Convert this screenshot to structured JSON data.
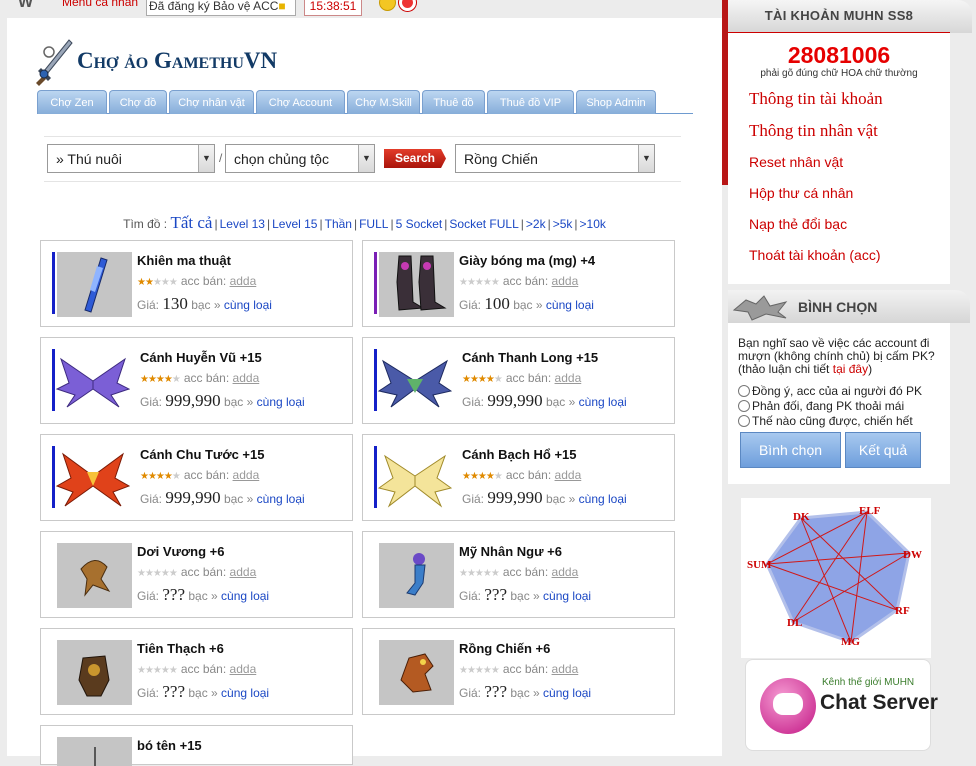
{
  "topbar": {
    "logo_letter": "W",
    "menu_label": "Menu cá nhân",
    "register_box": "Đã đăng ký Bảo vệ ACC",
    "clock": "15:38:51"
  },
  "brand": {
    "title": "Chợ ảo GamethuVN"
  },
  "tabs": [
    "Chợ Zen",
    "Chợ đồ",
    "Chợ nhân vật",
    "Chợ Account",
    "Chợ M.Skill",
    "Thuê đồ",
    "Thuê đồ VIP",
    "Shop Admin"
  ],
  "filters": {
    "category": "» Thú nuôi",
    "race": "chọn chủng tộc",
    "search_label": "Search",
    "item": "Rồng Chiến"
  },
  "quicklinks": {
    "prefix": "Tìm đồ :",
    "all": "Tất cả",
    "links": [
      "Level 13",
      "Level 15",
      "Thần",
      "FULL",
      "5 Socket",
      "Socket FULL",
      ">2k",
      ">5k",
      ">10k"
    ]
  },
  "items": [
    {
      "name": "Khiên ma thuật",
      "stars": 2,
      "seller_label": "acc bán:",
      "seller": "adda",
      "price_label": "Giá:",
      "price": "130",
      "currency": "bạc",
      "same": "cùng loại"
    },
    {
      "name": "Giày bóng ma (mg) +4",
      "stars": 0,
      "seller_label": "acc bán:",
      "seller": "adda",
      "price_label": "Giá:",
      "price": "100",
      "currency": "bạc",
      "same": "cùng loại"
    },
    {
      "name": "Cánh Huyễn Vũ +15",
      "stars": 4,
      "seller_label": "acc bán:",
      "seller": "adda",
      "price_label": "Giá:",
      "price": "999,990",
      "currency": "bạc",
      "same": "cùng loại"
    },
    {
      "name": "Cánh Thanh Long +15",
      "stars": 4,
      "seller_label": "acc bán:",
      "seller": "adda",
      "price_label": "Giá:",
      "price": "999,990",
      "currency": "bạc",
      "same": "cùng loại"
    },
    {
      "name": "Cánh Chu Tước +15",
      "stars": 4,
      "seller_label": "acc bán:",
      "seller": "adda",
      "price_label": "Giá:",
      "price": "999,990",
      "currency": "bạc",
      "same": "cùng loại"
    },
    {
      "name": "Cánh Bạch Hổ +15",
      "stars": 4,
      "seller_label": "acc bán:",
      "seller": "adda",
      "price_label": "Giá:",
      "price": "999,990",
      "currency": "bạc",
      "same": "cùng loại"
    },
    {
      "name": "Dơi Vương +6",
      "stars": 0,
      "seller_label": "acc bán:",
      "seller": "adda",
      "price_label": "Giá:",
      "price": "???",
      "currency": "bạc",
      "same": "cùng loại"
    },
    {
      "name": "Mỹ Nhân Ngư +6",
      "stars": 0,
      "seller_label": "acc bán:",
      "seller": "adda",
      "price_label": "Giá:",
      "price": "???",
      "currency": "bạc",
      "same": "cùng loại"
    },
    {
      "name": "Tiên Thạch +6",
      "stars": 0,
      "seller_label": "acc bán:",
      "seller": "adda",
      "price_label": "Giá:",
      "price": "???",
      "currency": "bạc",
      "same": "cùng loại"
    },
    {
      "name": "Rồng Chiến +6",
      "stars": 0,
      "seller_label": "acc bán:",
      "seller": "adda",
      "price_label": "Giá:",
      "price": "???",
      "currency": "bạc",
      "same": "cùng loại"
    },
    {
      "name": "bó tên +15"
    }
  ],
  "account": {
    "title": "TÀI KHOẢN MUHN SS8",
    "code": "28081006",
    "hint": "phải gõ đúng chữ HOA chữ thường",
    "links": [
      "Thông tin tài khoản",
      "Thông tin nhân vật",
      "Reset nhân vật",
      "Hộp thư cá nhân",
      "Nạp thẻ đổi bạc",
      "Thoát tài khoản (acc)"
    ]
  },
  "poll": {
    "title": "BÌNH CHỌN",
    "question": "Bạn nghĩ sao về việc các account đi mượn (không chính chủ) bị cấm PK? (thảo luận chi tiết",
    "question_link": "tại đây",
    "question_end": ")",
    "options": [
      "Đồng ý, acc của ai người đó PK",
      "Phản đối, đang PK thoải mái",
      "Thế nào cũng được, chiến hết"
    ],
    "vote_label": "Bình chọn",
    "result_label": "Kết quả"
  },
  "classmap": {
    "labels": [
      "DK",
      "ELF",
      "DW",
      "RF",
      "MG",
      "DL",
      "SUM"
    ]
  },
  "chat": {
    "subtitle": "Kênh thế giới MUHN",
    "title": "Chat Server"
  }
}
